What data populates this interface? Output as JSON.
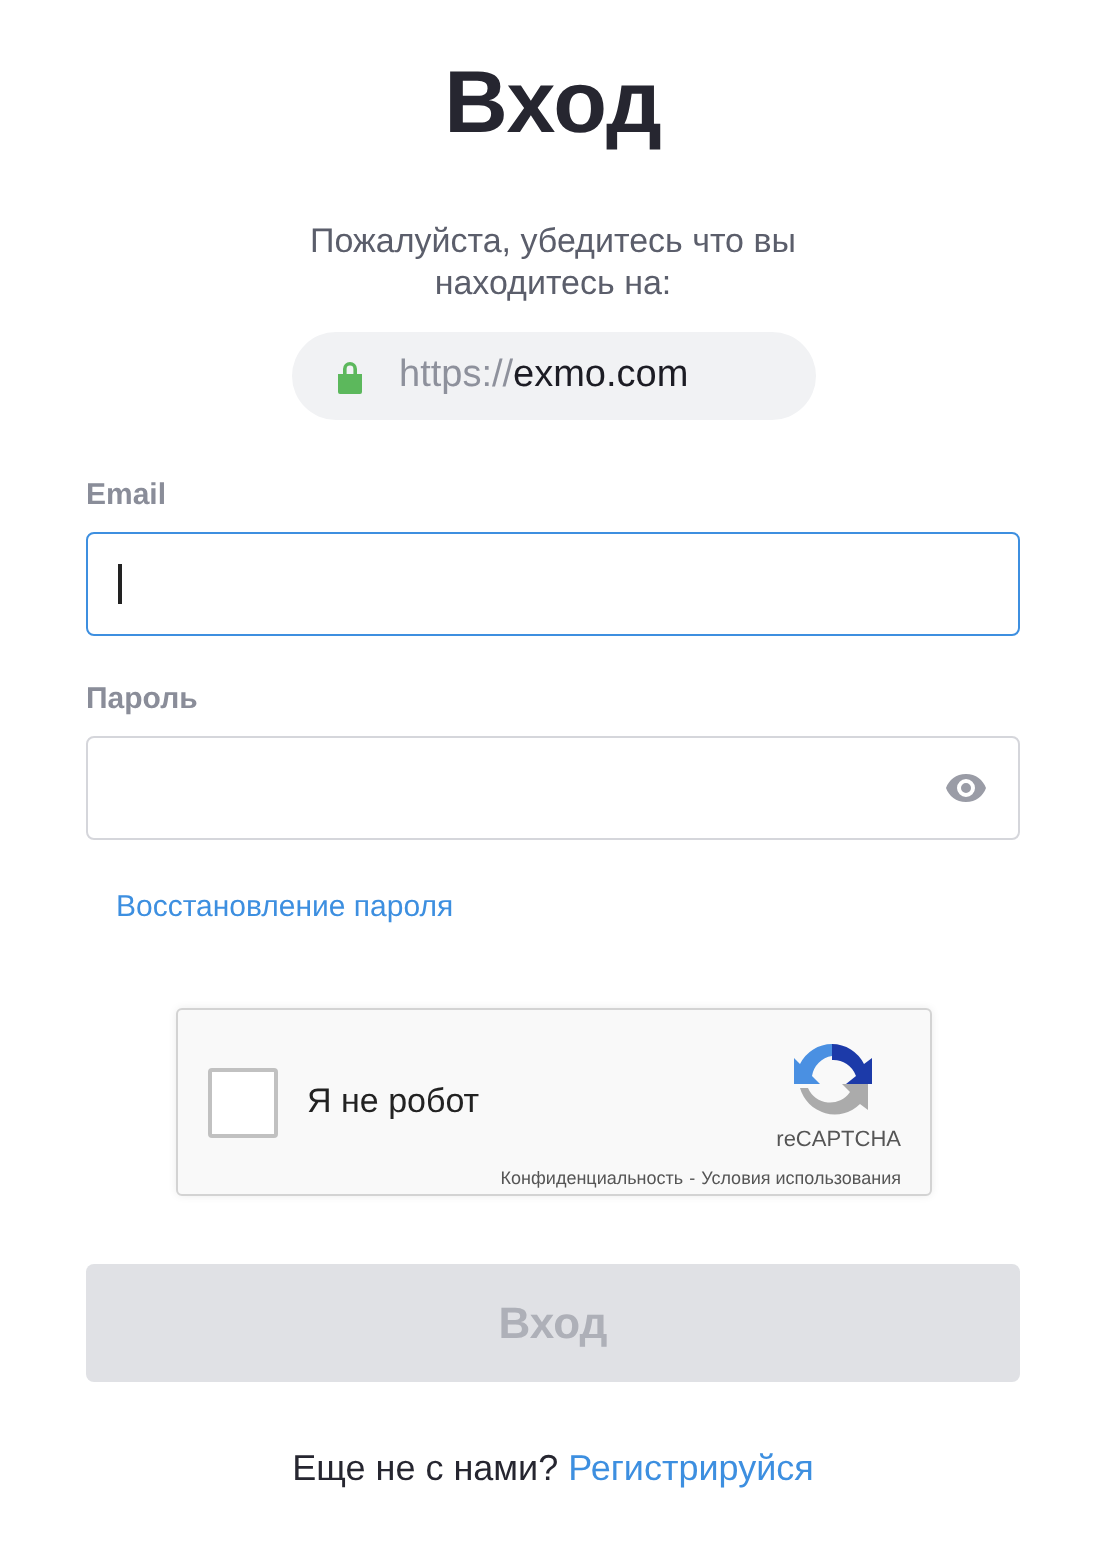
{
  "title": "Вход",
  "notice": "Пожалуйста, убедитесь что вы находитесь на:",
  "url": {
    "scheme": "https://",
    "host": "exmo.com"
  },
  "fields": [
    {
      "label": "Email",
      "kind": "text",
      "focused": true
    },
    {
      "label": "Пароль",
      "kind": "password",
      "focused": false
    }
  ],
  "recover_link": "Восстановление пароля",
  "captcha": {
    "label": "Я не робот",
    "checked": false,
    "brand": "reCAPTCHA",
    "privacy": "Конфиденциальность",
    "separator": "-",
    "terms": "Условия использования"
  },
  "submit": {
    "label": "Вход",
    "disabled": true
  },
  "footer": {
    "question": "Еще не с нами?",
    "link": "Регистрируйся"
  }
}
